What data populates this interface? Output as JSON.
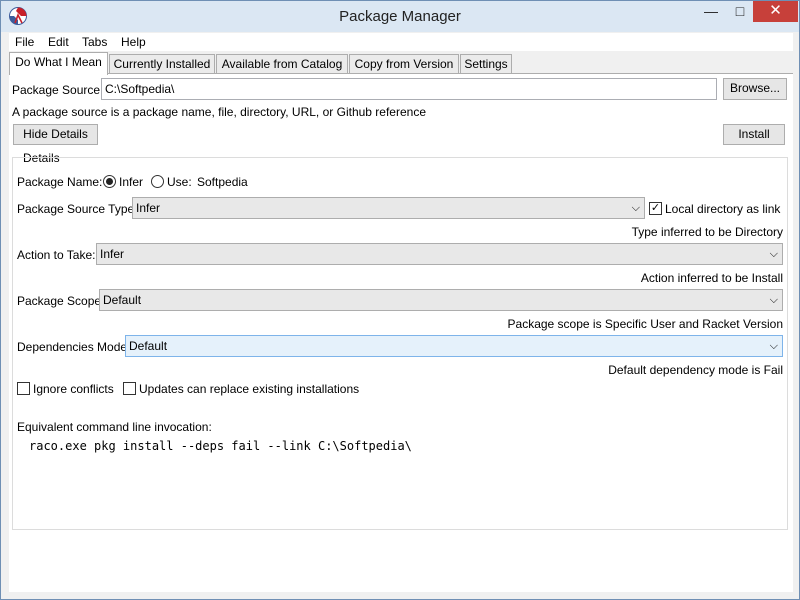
{
  "window": {
    "title": "Package Manager"
  },
  "menu": [
    "File",
    "Edit",
    "Tabs",
    "Help"
  ],
  "tabs": [
    "Do What I Mean",
    "Currently Installed",
    "Available from Catalog",
    "Copy from Version",
    "Settings"
  ],
  "source": {
    "label": "Package Source:",
    "value": "C:\\Softpedia\\",
    "browse": "Browse...",
    "hint": "A package source is a package name, file, directory, URL, or Github reference"
  },
  "actions": {
    "hide_details": "Hide Details",
    "install": "Install"
  },
  "details": {
    "group_title": "Details",
    "package_name_label": "Package Name:",
    "infer_label": "Infer",
    "use_label": "Use:",
    "use_value": "Softpedia",
    "source_type_label": "Package Source Type:",
    "source_type_value": "Infer",
    "local_dir_label": "Local directory as link",
    "source_type_note": "Type inferred to be Directory",
    "action_label": "Action to Take:",
    "action_value": "Infer",
    "action_note": "Action inferred to be Install",
    "scope_label": "Package Scope:",
    "scope_value": "Default",
    "scope_note": "Package scope is Specific User and Racket Version",
    "deps_label": "Dependencies Mode:",
    "deps_value": "Default",
    "deps_note": "Default dependency mode is Fail",
    "ignore_conflicts": "Ignore conflicts",
    "updates_replace": "Updates can replace existing installations",
    "cmd_label": "Equivalent command line invocation:",
    "cmd_value": "raco.exe pkg install --deps fail --link C:\\Softpedia\\"
  },
  "colors": {
    "close_button": "#c7403a",
    "titlebar": "#dbe7f3",
    "focus_border": "#7eb4ea"
  }
}
